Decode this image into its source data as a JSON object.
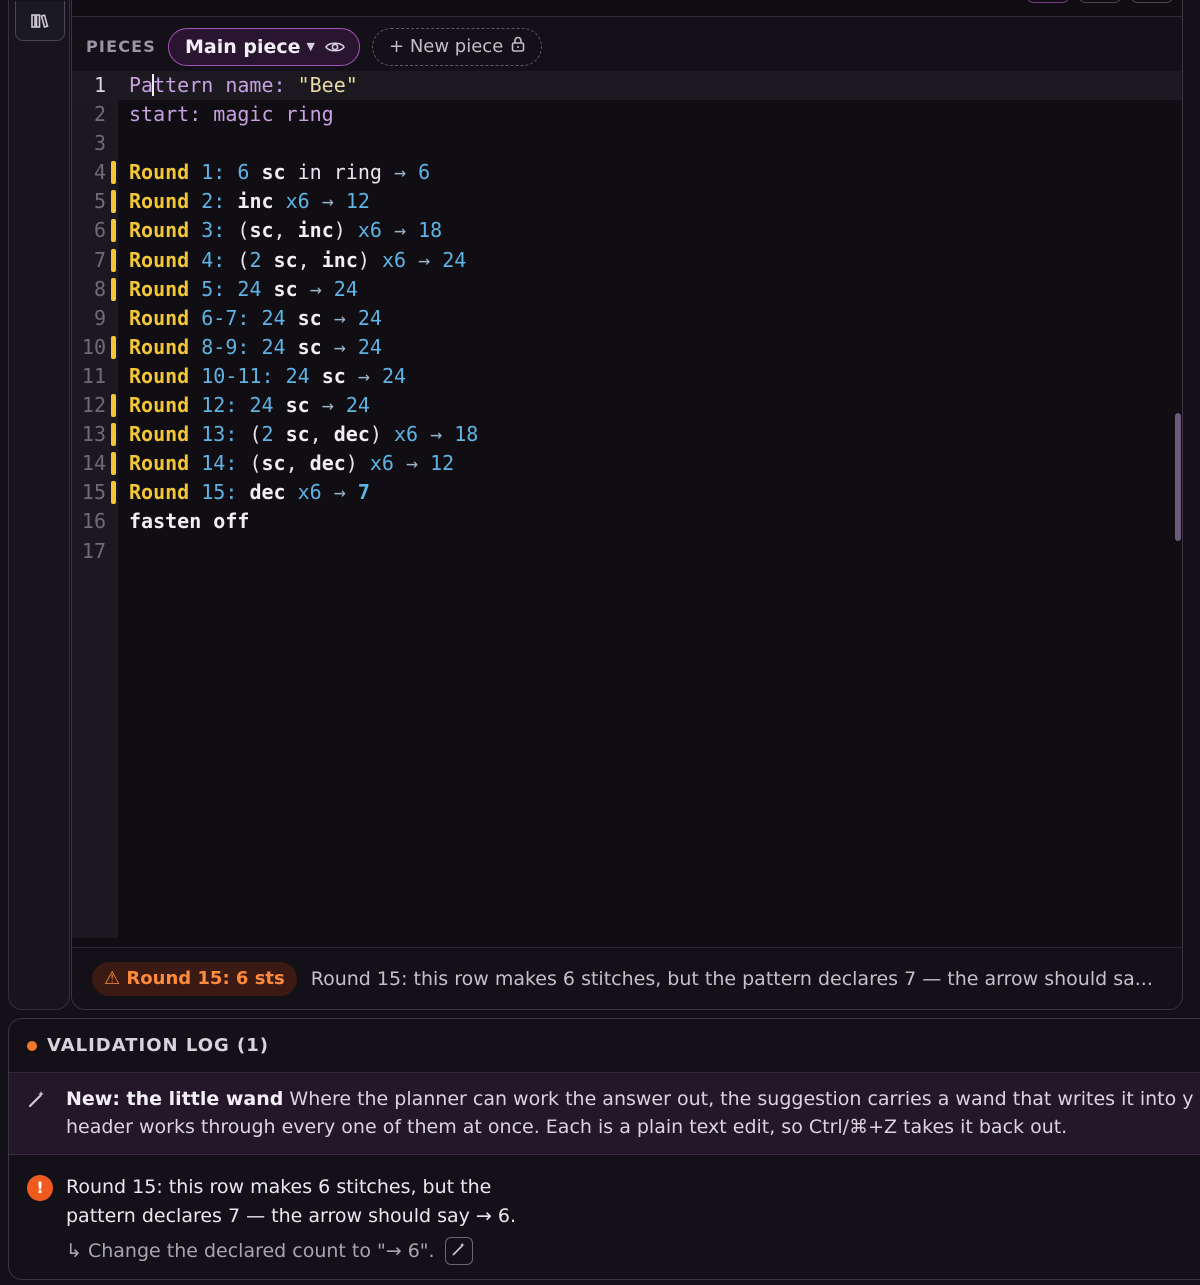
{
  "rail": {
    "library_icon": "library-icon"
  },
  "pieces": {
    "label": "PIECES",
    "main_piece": "Main piece",
    "new_piece": "+ New piece"
  },
  "editor": {
    "lines": [
      {
        "n": "1"
      },
      {
        "n": "2"
      },
      {
        "n": "3"
      },
      {
        "n": "4"
      },
      {
        "n": "5"
      },
      {
        "n": "6"
      },
      {
        "n": "7"
      },
      {
        "n": "8"
      },
      {
        "n": "9"
      },
      {
        "n": "10"
      },
      {
        "n": "11"
      },
      {
        "n": "12"
      },
      {
        "n": "13"
      },
      {
        "n": "14"
      },
      {
        "n": "15"
      },
      {
        "n": "16"
      },
      {
        "n": "17"
      }
    ],
    "code": {
      "l1_key": "Pattern name:",
      "l1_val": "\"Bee\"",
      "l2_key": "start:",
      "l2_val": "magic ring",
      "round": "Round",
      "r1_num": "1:",
      "r1_a": "6",
      "r1_sc": "sc",
      "r1_in": "in ring",
      "r1_arrow": "→",
      "r1_total": "6",
      "r2_num": "2:",
      "r2_inc": "inc",
      "r2_x": "x6",
      "r2_arrow": "→",
      "r2_total": "12",
      "r3_num": "3:",
      "r3_open": "(",
      "r3_sc": "sc",
      "r3_comma": ",",
      "r3_inc": "inc",
      "r3_close": ")",
      "r3_x": "x6",
      "r3_arrow": "→",
      "r3_total": "18",
      "r4_num": "4:",
      "r4_open": "(",
      "r4_n": "2",
      "r4_sc": "sc",
      "r4_comma": ",",
      "r4_inc": "inc",
      "r4_close": ")",
      "r4_x": "x6",
      "r4_arrow": "→",
      "r4_total": "24",
      "r5_num": "5:",
      "r5_n": "24",
      "r5_sc": "sc",
      "r5_arrow": "→",
      "r5_total": "24",
      "r6_num": "6-7:",
      "r6_n": "24",
      "r6_sc": "sc",
      "r6_arrow": "→",
      "r6_total": "24",
      "r7_num": "8-9:",
      "r7_n": "24",
      "r7_sc": "sc",
      "r7_arrow": "→",
      "r7_total": "24",
      "r8_num": "10-11:",
      "r8_n": "24",
      "r8_sc": "sc",
      "r8_arrow": "→",
      "r8_total": "24",
      "r9_num": "12:",
      "r9_n": "24",
      "r9_sc": "sc",
      "r9_arrow": "→",
      "r9_total": "24",
      "r10_num": "13:",
      "r10_open": "(",
      "r10_n": "2",
      "r10_sc": "sc",
      "r10_comma": ",",
      "r10_dec": "dec",
      "r10_close": ")",
      "r10_x": "x6",
      "r10_arrow": "→",
      "r10_total": "18",
      "r11_num": "14:",
      "r11_open": "(",
      "r11_sc": "sc",
      "r11_comma": ",",
      "r11_dec": "dec",
      "r11_close": ")",
      "r11_x": "x6",
      "r11_arrow": "→",
      "r11_total": "12",
      "r12_num": "15:",
      "r12_dec": "dec",
      "r12_x": "x6",
      "r12_arrow": "→",
      "r12_total": "7",
      "l16": "fasten off"
    }
  },
  "status": {
    "badge": "⚠ Round 15: 6 sts",
    "message": "Round 15: this row makes 6 stitches, but the pattern declares 7 — the arrow should sa..."
  },
  "validation_log": {
    "title": "VALIDATION LOG (1)",
    "notice_title": "New: the little wand",
    "notice_body_1": "Where the planner can work the answer out, the suggestion carries a wand that writes it into y",
    "notice_body_2": "header works through every one of them at once. Each is a plain text edit, so Ctrl/⌘+Z takes it back out.",
    "issue_text": "Round 15: this row makes 6 stitches, but the pattern declares 7 — the arrow should say → 6.",
    "fix_text": "↳ Change the declared count to \"→ 6\"."
  },
  "colors": {
    "accent": "#a653b8",
    "round_marker": "#f2c637",
    "warning": "#ff8a3a",
    "error": "#f05a1e"
  }
}
